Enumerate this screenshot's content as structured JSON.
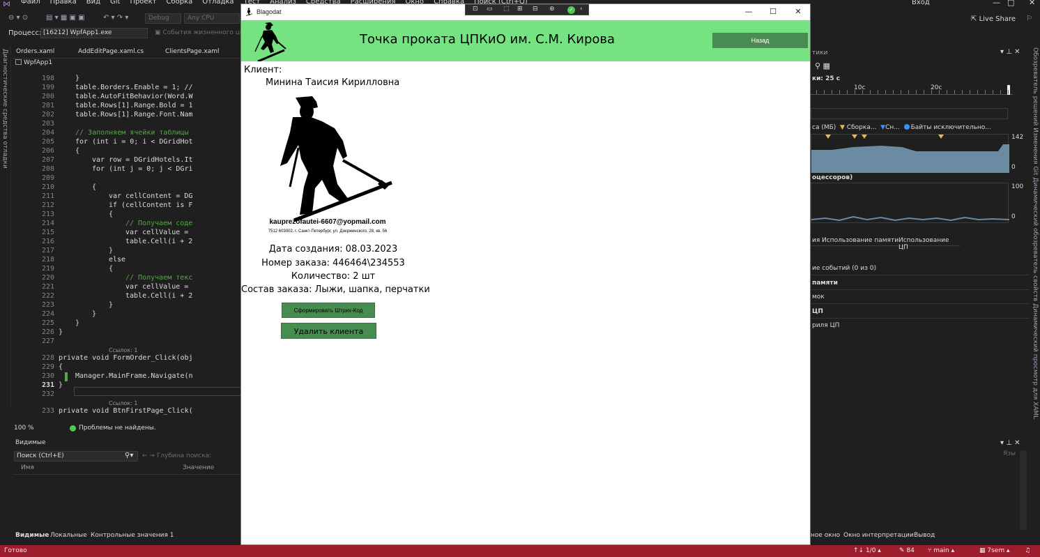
{
  "vs": {
    "menu": [
      "Файл",
      "Правка",
      "Вид",
      "Git",
      "Проект",
      "Сборка",
      "Отладка",
      "Тест",
      "Анализ",
      "Средства",
      "Расширения",
      "Окно",
      "Справка",
      "Поиск (Ctrl+Q)"
    ],
    "signin": "Вход",
    "toolbar": {
      "config": "Debug",
      "platform": "Any CPU",
      "live_share": "Live Share"
    },
    "process": {
      "label": "Процесс:",
      "value": "[16212] WpfApp1.exe",
      "lifecycle": "События жизненного цикла"
    },
    "doc_tabs": [
      "Orders.xaml",
      "AddEditPage.xaml.cs",
      "ClientsPage.xaml"
    ],
    "project": "WpfApp1",
    "left_strip": "Диагностические средства отладки",
    "right_strip": "Обозреватель решений   Изменения Git   Динамический обозреватель свойств   Динамический просмотр для XAML",
    "code": [
      {
        "n": "198",
        "t": "}",
        "c": "plain",
        "indent": 6
      },
      {
        "n": "199",
        "t": "table.Borders.Enable = 1; //",
        "c": "plain",
        "indent": 6
      },
      {
        "n": "200",
        "t": "table.AutoFitBehavior(Word.W",
        "c": "plain",
        "indent": 6
      },
      {
        "n": "201",
        "t": "table.Rows[1].Range.Bold = 1",
        "c": "plain",
        "indent": 6
      },
      {
        "n": "202",
        "t": "table.Rows[1].Range.Font.Nam",
        "c": "plain",
        "indent": 6
      },
      {
        "n": "203",
        "t": "",
        "c": "plain",
        "indent": 6
      },
      {
        "n": "204",
        "t": "// Заполняем ячейки таблицы",
        "c": "comment",
        "indent": 6
      },
      {
        "n": "205",
        "t": "for (int i = 0; i < DGridHot",
        "c": "plain",
        "indent": 6
      },
      {
        "n": "206",
        "t": "{",
        "c": "plain",
        "indent": 6
      },
      {
        "n": "207",
        "t": "var row = DGridHotels.It",
        "c": "plain",
        "indent": 10
      },
      {
        "n": "208",
        "t": "for (int j = 0; j < DGri",
        "c": "plain",
        "indent": 10
      },
      {
        "n": "209",
        "t": "",
        "c": "plain",
        "indent": 10
      },
      {
        "n": "210",
        "t": "{",
        "c": "plain",
        "indent": 10
      },
      {
        "n": "211",
        "t": "var cellContent = DG",
        "c": "plain",
        "indent": 14
      },
      {
        "n": "212",
        "t": "if (cellContent is F",
        "c": "plain",
        "indent": 14
      },
      {
        "n": "213",
        "t": "{",
        "c": "plain",
        "indent": 14
      },
      {
        "n": "214",
        "t": "// Получаем соде",
        "c": "comment",
        "indent": 18
      },
      {
        "n": "215",
        "t": "var cellValue =",
        "c": "plain",
        "indent": 18
      },
      {
        "n": "216",
        "t": "table.Cell(i + 2",
        "c": "plain",
        "indent": 18
      },
      {
        "n": "217",
        "t": "}",
        "c": "plain",
        "indent": 14
      },
      {
        "n": "218",
        "t": "else",
        "c": "plain",
        "indent": 14
      },
      {
        "n": "219",
        "t": "{",
        "c": "plain",
        "indent": 14
      },
      {
        "n": "220",
        "t": "// Получаем текс",
        "c": "comment",
        "indent": 18
      },
      {
        "n": "221",
        "t": "var cellValue =",
        "c": "plain",
        "indent": 18
      },
      {
        "n": "222",
        "t": "table.Cell(i + 2",
        "c": "plain",
        "indent": 18
      },
      {
        "n": "223",
        "t": "}",
        "c": "plain",
        "indent": 14
      },
      {
        "n": "224",
        "t": "}",
        "c": "plain",
        "indent": 10
      },
      {
        "n": "225",
        "t": "}",
        "c": "plain",
        "indent": 6
      },
      {
        "n": "226",
        "t": "}",
        "c": "plain",
        "indent": 2
      },
      {
        "n": "227",
        "t": "",
        "c": "plain",
        "indent": 2
      }
    ],
    "code_ref_1": "Ссылок: 1",
    "code_tail": [
      {
        "n": "228",
        "t": "private void FormOrder_Click(obj",
        "c": "plain",
        "indent": 2
      },
      {
        "n": "229",
        "t": "{",
        "c": "plain",
        "indent": 2
      },
      {
        "n": "230",
        "t": "Manager.MainFrame.Navigate(n",
        "c": "plain",
        "indent": 6
      },
      {
        "n": "231",
        "t": "}",
        "c": "plain",
        "indent": 2
      },
      {
        "n": "232",
        "t": "",
        "c": "plain",
        "indent": 2
      }
    ],
    "code_ref_2": "Ссылок: 1",
    "code_last": {
      "n": "233",
      "t": "private void BtnFirstPage_Click(",
      "c": "plain",
      "indent": 2
    },
    "editor_status": {
      "zoom": "100 %",
      "issues": "Проблемы не найдены."
    },
    "watch": {
      "title": "Видимые",
      "search": "Поиск (Ctrl+E)",
      "depth": "Глубина поиска:",
      "col_name": "Имя",
      "col_value": "Значение",
      "tabs": [
        "Видимые",
        "Локальные",
        "Контрольные значения 1"
      ]
    },
    "diag": {
      "title": "тики",
      "session": "ки: 25 с",
      "timeline": [
        "10с",
        "20с"
      ],
      "legend_mem": "са (МБ)",
      "legend_gc": "Сборка...",
      "legend_snap": "Сн...",
      "legend_bytes": "Байты исключительно...",
      "mem_max": "142",
      "mem_min": "0",
      "cpu_title": "оцессоров)",
      "cpu_max": "100",
      "cpu_min": "0",
      "tabs": [
        "ия",
        "Использование памяти",
        "Использование ЦП"
      ],
      "rows": [
        "ие событий (0 из 0)",
        "памяти",
        "мок",
        "ЦП",
        "риля ЦП"
      ],
      "bottom_lang": "Язы",
      "bottom_tabs": [
        "ное окно",
        "Окно интерпретации",
        "Вывод"
      ]
    },
    "status": {
      "ready": "Готово",
      "position": "↑↓ 1/0 ▴",
      "edits": "84",
      "branch": "main ▴",
      "repo": "7sem ▴"
    }
  },
  "app": {
    "window_title": "Blagodat",
    "header_title": "Точка проката ЦПКиО им. С.М. Кирова",
    "back_label": "Назад",
    "client_label": "Клиент:",
    "client_name": "Минина Таисия Кирилловна",
    "email": "kauprezofautei-6607@yopmail.com",
    "address": "7512  603002, г. Санкт-Петербург, ул. Дзержинского, 28, кв. 56",
    "created": "Дата создания: 08.03.2023",
    "order_no": "Номер заказа: 446464\\234553",
    "quantity": "Количество: 2 шт",
    "composition": "Состав заказа: Лыжи, шапка, перчатки",
    "barcode_label": "Сформировать Штрих-Код",
    "delete_label": "Удалить клиента",
    "header_color": "#76e383",
    "button_color": "#498c51"
  }
}
